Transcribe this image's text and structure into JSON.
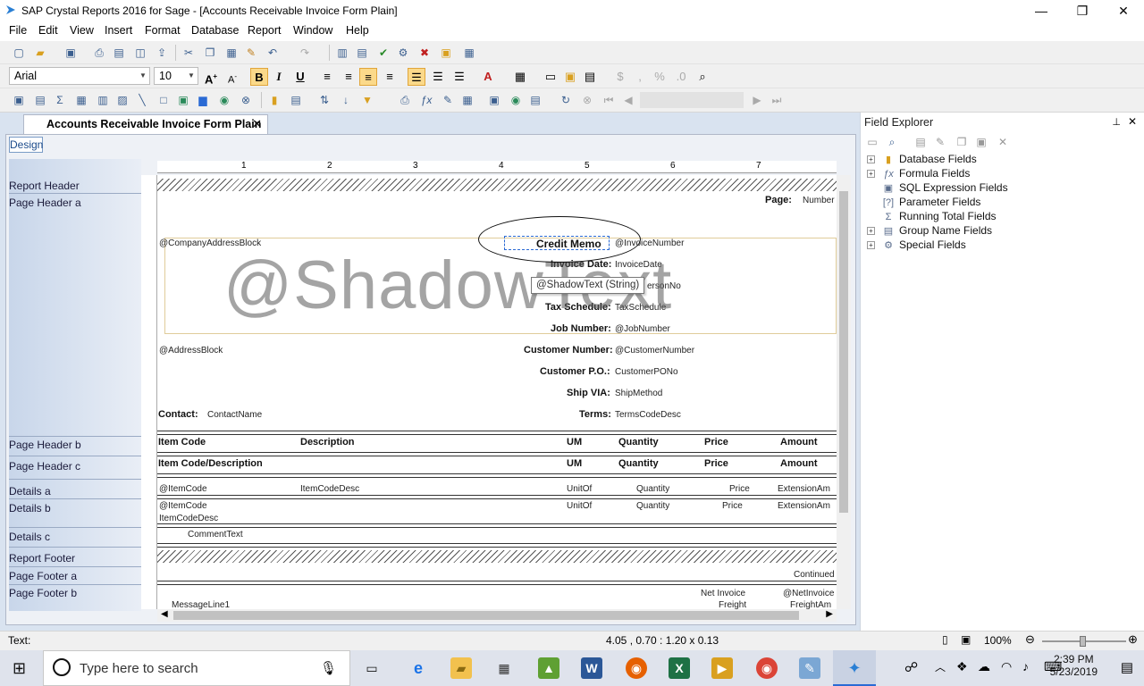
{
  "window": {
    "title": "SAP Crystal Reports 2016 for Sage - [Accounts Receivable Invoice Form Plain]"
  },
  "menu": [
    "File",
    "Edit",
    "View",
    "Insert",
    "Format",
    "Database",
    "Report",
    "Window",
    "Help"
  ],
  "format_toolbar": {
    "font": "Arial",
    "size": "10"
  },
  "doc_tab": {
    "label": "Accounts Receivable Invoice Form Plain"
  },
  "design_tab": "Design",
  "ruler": [
    "1",
    "2",
    "3",
    "4",
    "5",
    "6",
    "7"
  ],
  "sections": [
    "Report Header",
    "Page Header a",
    "Page Header b",
    "Page Header c",
    "Details a",
    "Details b",
    "Details c",
    "Report Footer",
    "Page Footer a",
    "Page Footer b"
  ],
  "fields": {
    "page": "Page:",
    "number": "Number",
    "company": "@CompanyAddressBlock",
    "credit_memo": "Credit Memo",
    "invoice_number": "@InvoiceNumber",
    "invoice_date_label": "Invoice Date:",
    "invoice_date": "InvoiceDate",
    "salesperson": "ersonNo",
    "tax_label": "Tax Schedule:",
    "tax": "TaxSchedule",
    "job_label": "Job Number:",
    "job": "@JobNumber",
    "address": "@AddressBlock",
    "cust_label": "Customer Number:",
    "cust": "@CustomerNumber",
    "po_label": "Customer P.O.:",
    "po": "CustomerPONo",
    "ship_label": "Ship VIA:",
    "ship": "ShipMethod",
    "contact_label": "Contact:",
    "contact": "ContactName",
    "terms_label": "Terms:",
    "terms": "TermsCodeDesc"
  },
  "shadow_text": "@ShadowText",
  "tooltip": "@ShadowText (String)",
  "ph_b": {
    "item": "Item Code",
    "desc": "Description",
    "um": "UM",
    "qty": "Quantity",
    "price": "Price",
    "amount": "Amount"
  },
  "ph_c": {
    "item": "Item Code/Description",
    "um": "UM",
    "qty": "Quantity",
    "price": "Price",
    "amount": "Amount"
  },
  "det_a": {
    "item": "@ItemCode",
    "desc": "ItemCodeDesc",
    "um": "UnitOf",
    "qty": "Quantity",
    "price": "Price",
    "ext": "ExtensionAm"
  },
  "det_b": {
    "item": "@ItemCode",
    "desc": "ItemCodeDesc",
    "um": "UnitOf",
    "qty": "Quantity",
    "price": "Price",
    "ext": "ExtensionAm"
  },
  "det_c": {
    "comment": "CommentText"
  },
  "pf_a": {
    "continued": "Continued"
  },
  "pf_b": {
    "message": "MessageLine1",
    "net_invoice": "Net Invoice",
    "freight": "Freight",
    "net_field": "@NetInvoice",
    "freight_field": "FreightAm"
  },
  "explorer": {
    "title": "Field Explorer",
    "items": [
      {
        "label": "Database Fields",
        "expander": "+"
      },
      {
        "label": "Formula Fields",
        "expander": "+"
      },
      {
        "label": "SQL Expression Fields",
        "expander": ""
      },
      {
        "label": "Parameter Fields",
        "expander": ""
      },
      {
        "label": "Running Total Fields",
        "expander": ""
      },
      {
        "label": "Group Name Fields",
        "expander": "+"
      },
      {
        "label": "Special Fields",
        "expander": "+"
      }
    ]
  },
  "status": {
    "left": "Text:",
    "coords": "4.05 , 0.70 : 1.20 x 0.13",
    "zoom": "100%"
  },
  "taskbar": {
    "search": "Type here to search",
    "time": "2:39 PM",
    "date": "5/23/2019"
  }
}
